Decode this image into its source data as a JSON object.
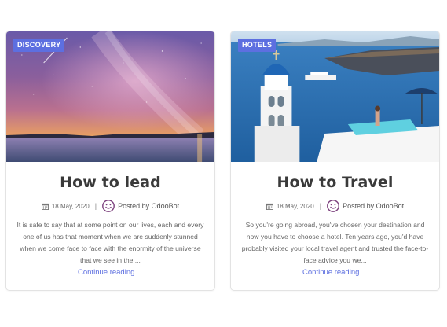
{
  "posts": [
    {
      "badge": "DISCOVERY",
      "title": "How to lead",
      "date": "18 May, 2020",
      "separator": "|",
      "author": "Posted by OdooBot",
      "excerpt": "It is safe to say that at some point on our lives, each and every one of us has that moment when we are suddenly stunned when we come face to face with the enormity of the universe that we see in the ...",
      "link": "Continue reading ...",
      "image": "night-sky-milky-way-over-sea",
      "icons": [
        "calendar-icon",
        "avatar-smiley-icon"
      ]
    },
    {
      "badge": "HOTELS",
      "title": "How to Travel",
      "date": "18 May, 2020",
      "separator": "|",
      "author": "Posted by OdooBot",
      "excerpt": "So you're going abroad, you've chosen your destination and now you have to choose a hotel. Ten years ago, you'd have probably visited your local travel agent and trusted the face-to-face advice you we...",
      "link": "Continue reading ...",
      "image": "santorini-blue-dome-church-sea",
      "icons": [
        "calendar-icon",
        "avatar-smiley-icon"
      ]
    }
  ],
  "colors": {
    "accent": "#5d6fe0",
    "title": "#3a3a3a",
    "text": "#666666",
    "avatar": "#7b3f7c"
  }
}
